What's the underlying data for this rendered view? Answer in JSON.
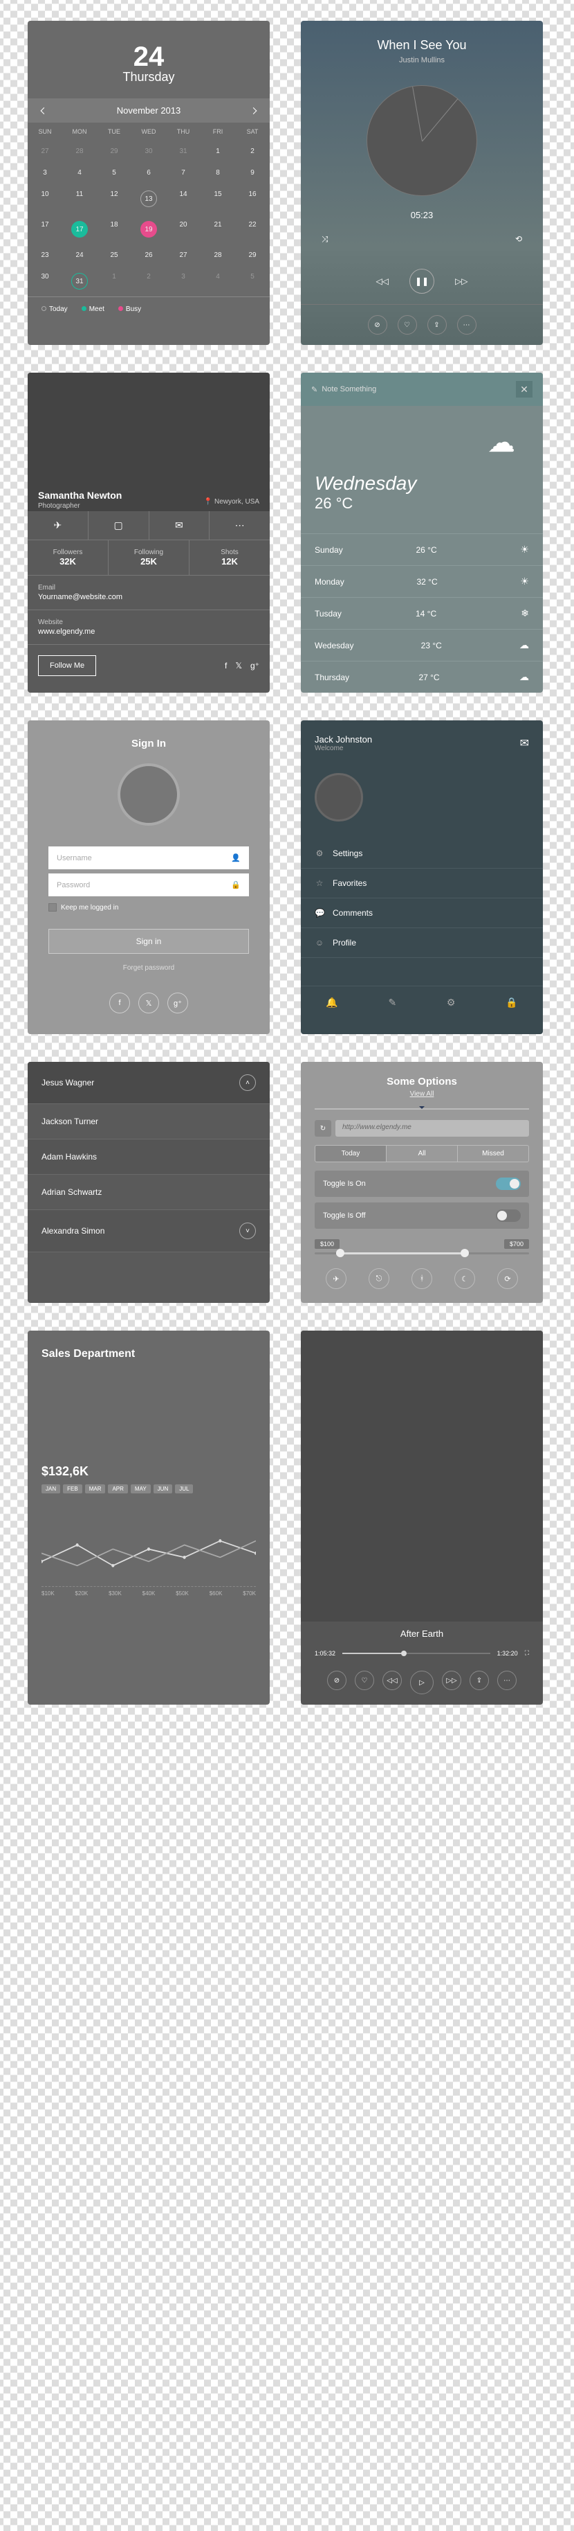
{
  "calendar": {
    "day": "24",
    "weekday": "Thursday",
    "month": "November 2013",
    "headers": [
      "SUN",
      "MON",
      "TUE",
      "WED",
      "THU",
      "FRI",
      "SAT"
    ],
    "legend": {
      "today": "Today",
      "meet": "Meet",
      "busy": "Busy"
    }
  },
  "music": {
    "title": "When I See You",
    "artist": "Justin Mullins",
    "time": "05:23"
  },
  "profile": {
    "name": "Samantha Newton",
    "job": "Photographer",
    "location": "Newyork, USA",
    "followers_l": "Followers",
    "followers_v": "32K",
    "following_l": "Following",
    "following_v": "25K",
    "shots_l": "Shots",
    "shots_v": "12K",
    "email_l": "Email",
    "email_v": "Yourname@website.com",
    "web_l": "Website",
    "web_v": "www.elgendy.me",
    "follow": "Follow Me"
  },
  "weather": {
    "note": "Note Something",
    "day": "Wednesday",
    "temp": "26 °C",
    "rows": [
      {
        "d": "Sunday",
        "t": "26 °C"
      },
      {
        "d": "Monday",
        "t": "32 °C"
      },
      {
        "d": "Tusday",
        "t": "14 °C"
      },
      {
        "d": "Wedesday",
        "t": "23 °C"
      },
      {
        "d": "Thursday",
        "t": "27 °C"
      }
    ]
  },
  "signin": {
    "title": "Sign In",
    "user_ph": "Username",
    "pass_ph": "Password",
    "remember": "Keep me logged in",
    "button": "Sign in",
    "forgot": "Forget password"
  },
  "menu": {
    "name": "Jack Johnston",
    "welcome": "Welcome",
    "items": [
      "Settings",
      "Favorites",
      "Comments",
      "Profile"
    ]
  },
  "contacts": {
    "items": [
      "Jesus Wagner",
      "Jackson Turner",
      "Adam Hawkins",
      "Adrian Schwartz",
      "Alexandra Simon"
    ]
  },
  "options": {
    "title": "Some Options",
    "viewall": "View All",
    "url": "http://www.elgendy.me",
    "seg": [
      "Today",
      "All",
      "Missed"
    ],
    "tog_on": "Toggle Is On",
    "tog_off": "Toggle Is Off",
    "range_lo": "$100",
    "range_hi": "$700"
  },
  "sales": {
    "title": "Sales Department",
    "total": "$132,6K",
    "months": [
      "JAN",
      "FEB",
      "MAR",
      "APR",
      "MAY",
      "JUN",
      "JUL"
    ],
    "xlabels": [
      "$10K",
      "$20K",
      "$30K",
      "$40K",
      "$50K",
      "$60K",
      "$70K"
    ]
  },
  "video": {
    "title": "After Earth",
    "t1": "1:05:32",
    "t2": "1:32:20"
  }
}
